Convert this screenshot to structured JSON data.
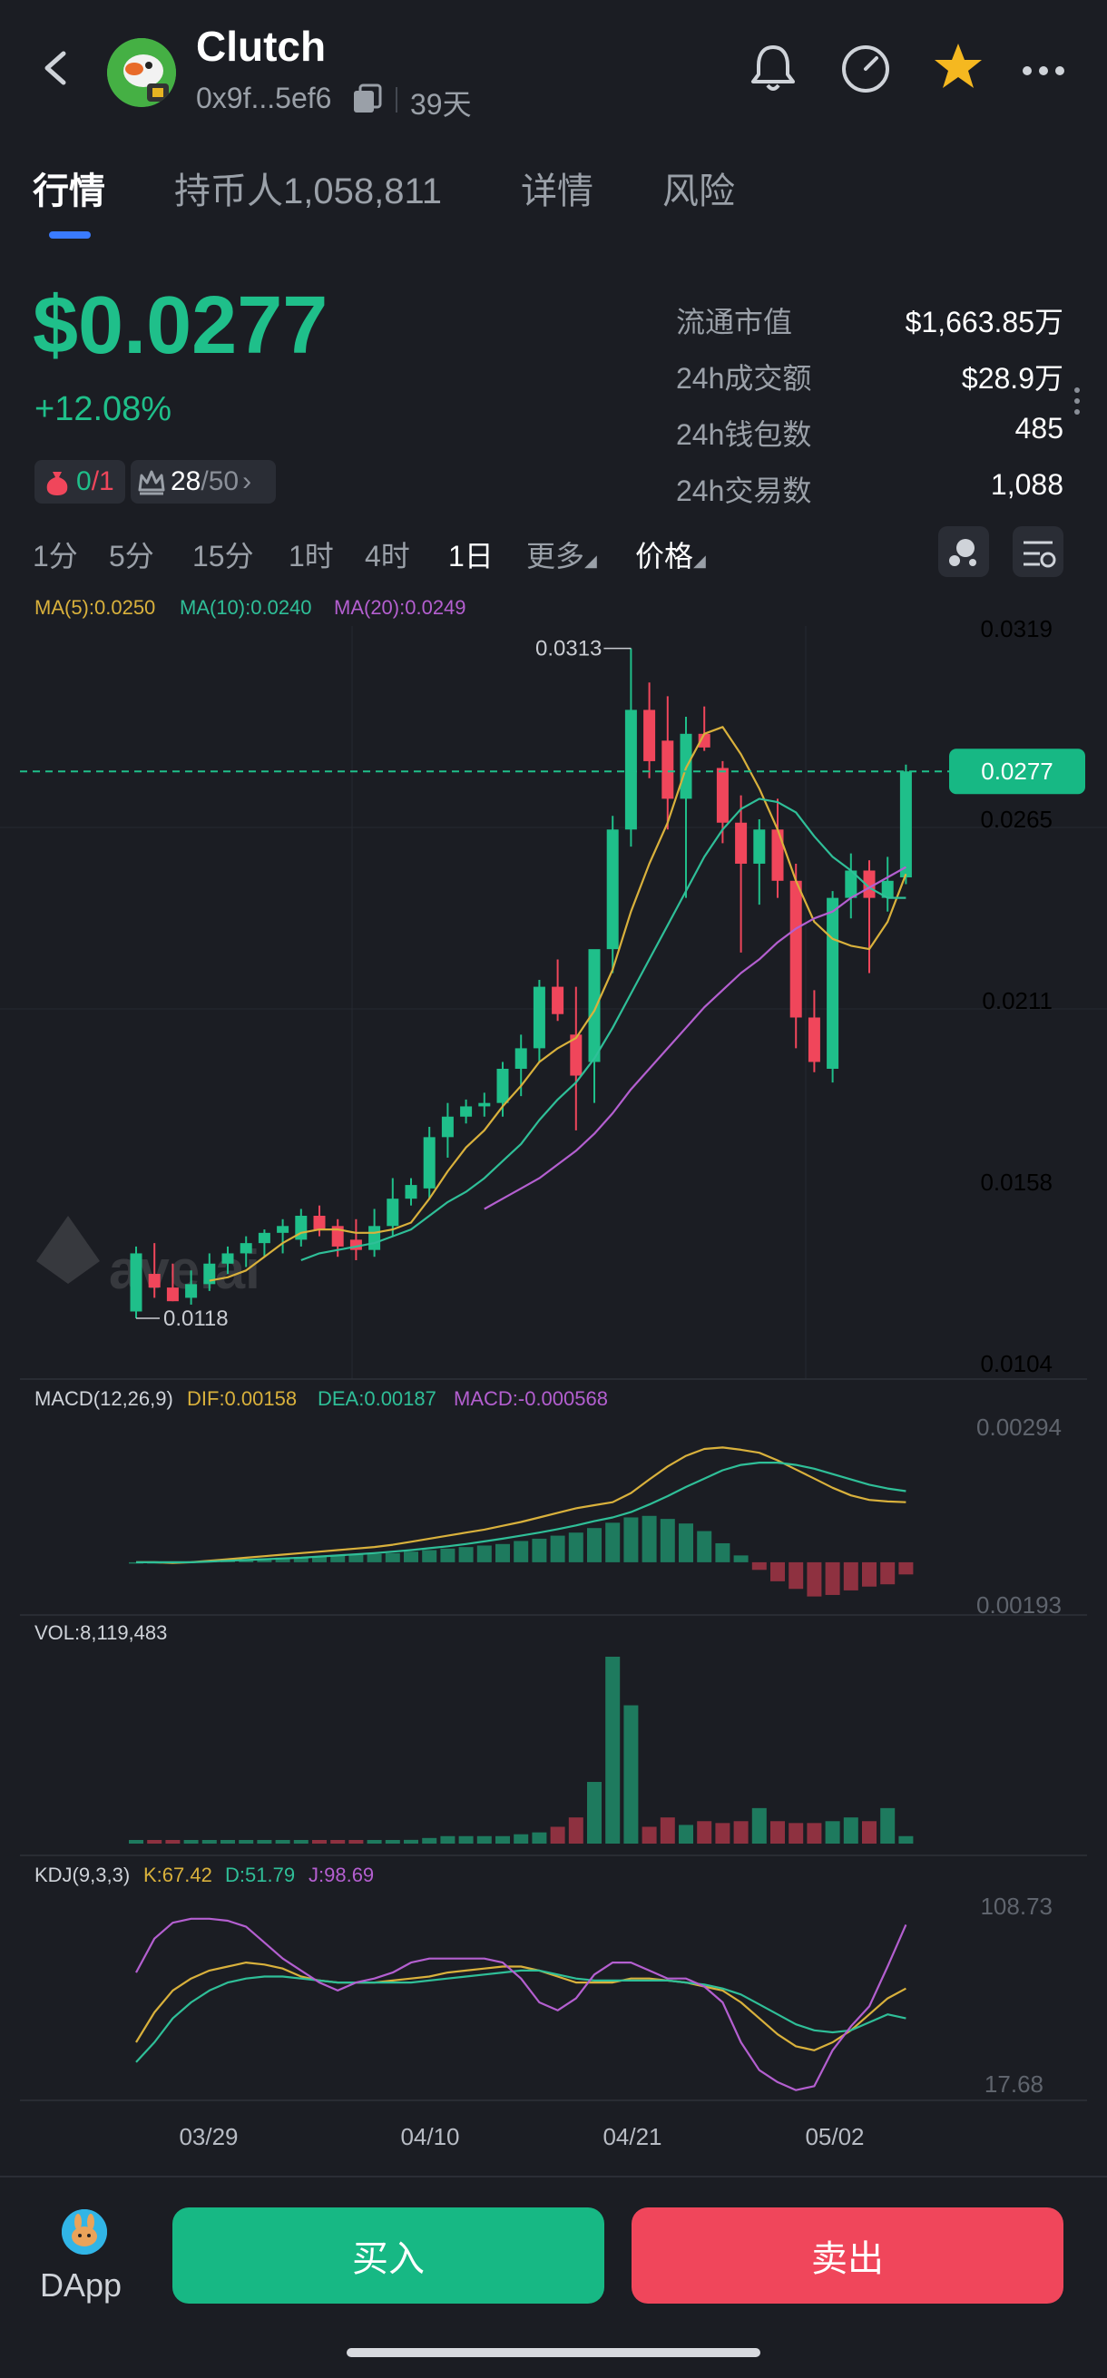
{
  "header": {
    "token_name": "Clutch",
    "address": "0x9f...5ef6",
    "age": "39天",
    "icons": [
      "back-icon",
      "bell-icon",
      "gauge-icon",
      "star-icon",
      "more-icon"
    ]
  },
  "tabs": [
    "行情",
    "持币人1,058,811",
    "详情",
    "风险"
  ],
  "price": {
    "value": "$0.0277",
    "change": "+12.08%",
    "badge1_a": "0",
    "badge1_b": "/1",
    "badge2_a": "28",
    "badge2_b": "/50"
  },
  "stats": [
    {
      "label": "流通市值",
      "value": "$1,663.85万"
    },
    {
      "label": "24h成交额",
      "value": "$28.9万"
    },
    {
      "label": "24h钱包数",
      "value": "485"
    },
    {
      "label": "24h交易数",
      "value": "1,088"
    }
  ],
  "intervals": [
    "1分",
    "5分",
    "15分",
    "1时",
    "4时",
    "1日",
    "更多",
    "价格"
  ],
  "active_interval": "1日",
  "colors": {
    "up": "#1fbf8a",
    "down": "#f0465b",
    "ma5": "#d9b13c",
    "ma10": "#2fbf98",
    "ma20": "#b45fd0",
    "accent": "#3a7bff"
  },
  "chart_data": {
    "type": "candlestick",
    "ma_legend": {
      "ma5": "MA(5):0.0250",
      "ma10": "MA(10):0.0240",
      "ma20": "MA(20):0.0249"
    },
    "y_ticks": [
      "0.0319",
      "0.0265",
      "0.0211",
      "0.0158",
      "0.0104"
    ],
    "high_label": "0.0313",
    "low_label": "0.0118",
    "current_price_tag": "0.0277",
    "x_ticks": [
      "03/29",
      "04/10",
      "04/21",
      "05/02"
    ],
    "candles": [
      {
        "o": 0.0119,
        "h": 0.0138,
        "l": 0.0117,
        "c": 0.0136
      },
      {
        "o": 0.013,
        "h": 0.0139,
        "l": 0.0123,
        "c": 0.0126
      },
      {
        "o": 0.0126,
        "h": 0.0133,
        "l": 0.0122,
        "c": 0.0122
      },
      {
        "o": 0.0123,
        "h": 0.0131,
        "l": 0.0121,
        "c": 0.0127
      },
      {
        "o": 0.0127,
        "h": 0.0136,
        "l": 0.0125,
        "c": 0.0133
      },
      {
        "o": 0.0133,
        "h": 0.0138,
        "l": 0.013,
        "c": 0.0136
      },
      {
        "o": 0.0136,
        "h": 0.0141,
        "l": 0.0132,
        "c": 0.0139
      },
      {
        "o": 0.0139,
        "h": 0.0143,
        "l": 0.0135,
        "c": 0.0142
      },
      {
        "o": 0.0142,
        "h": 0.0146,
        "l": 0.0136,
        "c": 0.0144
      },
      {
        "o": 0.014,
        "h": 0.0149,
        "l": 0.0138,
        "c": 0.0147
      },
      {
        "o": 0.0147,
        "h": 0.015,
        "l": 0.0141,
        "c": 0.0143
      },
      {
        "o": 0.0144,
        "h": 0.0146,
        "l": 0.0135,
        "c": 0.0138
      },
      {
        "o": 0.014,
        "h": 0.0146,
        "l": 0.0134,
        "c": 0.0137
      },
      {
        "o": 0.0137,
        "h": 0.0149,
        "l": 0.0135,
        "c": 0.0144
      },
      {
        "o": 0.0144,
        "h": 0.0158,
        "l": 0.0141,
        "c": 0.0152
      },
      {
        "o": 0.0152,
        "h": 0.0158,
        "l": 0.015,
        "c": 0.0156
      },
      {
        "o": 0.0155,
        "h": 0.0173,
        "l": 0.0152,
        "c": 0.017
      },
      {
        "o": 0.017,
        "h": 0.018,
        "l": 0.0164,
        "c": 0.0176
      },
      {
        "o": 0.0176,
        "h": 0.0181,
        "l": 0.0174,
        "c": 0.0179
      },
      {
        "o": 0.0179,
        "h": 0.0183,
        "l": 0.0176,
        "c": 0.018
      },
      {
        "o": 0.018,
        "h": 0.0192,
        "l": 0.0176,
        "c": 0.019
      },
      {
        "o": 0.019,
        "h": 0.02,
        "l": 0.0182,
        "c": 0.0196
      },
      {
        "o": 0.0196,
        "h": 0.0216,
        "l": 0.0192,
        "c": 0.0214
      },
      {
        "o": 0.0214,
        "h": 0.0222,
        "l": 0.0204,
        "c": 0.0206
      },
      {
        "o": 0.02,
        "h": 0.0214,
        "l": 0.0172,
        "c": 0.0188
      },
      {
        "o": 0.0192,
        "h": 0.0222,
        "l": 0.018,
        "c": 0.0225
      },
      {
        "o": 0.0225,
        "h": 0.0264,
        "l": 0.0218,
        "c": 0.026
      },
      {
        "o": 0.026,
        "h": 0.0313,
        "l": 0.0255,
        "c": 0.0295
      },
      {
        "o": 0.0295,
        "h": 0.0303,
        "l": 0.0275,
        "c": 0.028
      },
      {
        "o": 0.0286,
        "h": 0.0299,
        "l": 0.026,
        "c": 0.0269
      },
      {
        "o": 0.0269,
        "h": 0.0293,
        "l": 0.024,
        "c": 0.0288
      },
      {
        "o": 0.0288,
        "h": 0.0296,
        "l": 0.0283,
        "c": 0.0284
      },
      {
        "o": 0.0278,
        "h": 0.028,
        "l": 0.0256,
        "c": 0.0262
      },
      {
        "o": 0.0262,
        "h": 0.027,
        "l": 0.0224,
        "c": 0.025
      },
      {
        "o": 0.025,
        "h": 0.0263,
        "l": 0.0238,
        "c": 0.026
      },
      {
        "o": 0.026,
        "h": 0.0269,
        "l": 0.024,
        "c": 0.0245
      },
      {
        "o": 0.0245,
        "h": 0.025,
        "l": 0.0196,
        "c": 0.0205
      },
      {
        "o": 0.0205,
        "h": 0.0213,
        "l": 0.0189,
        "c": 0.0192
      },
      {
        "o": 0.019,
        "h": 0.0242,
        "l": 0.0186,
        "c": 0.024
      },
      {
        "o": 0.024,
        "h": 0.0253,
        "l": 0.0234,
        "c": 0.0248
      },
      {
        "o": 0.0248,
        "h": 0.0251,
        "l": 0.0218,
        "c": 0.024
      },
      {
        "o": 0.024,
        "h": 0.0252,
        "l": 0.0236,
        "c": 0.0245
      },
      {
        "o": 0.0246,
        "h": 0.0279,
        "l": 0.0244,
        "c": 0.0277
      }
    ],
    "ma5": [
      null,
      null,
      null,
      null,
      0.0128,
      0.0129,
      0.0131,
      0.0135,
      0.0139,
      0.0142,
      0.0143,
      0.0143,
      0.0142,
      0.0142,
      0.0143,
      0.0145,
      0.0152,
      0.016,
      0.0167,
      0.0172,
      0.0179,
      0.0185,
      0.0192,
      0.0196,
      0.0199,
      0.0207,
      0.0219,
      0.0236,
      0.025,
      0.0262,
      0.0278,
      0.0288,
      0.029,
      0.0282,
      0.0272,
      0.026,
      0.0245,
      0.0233,
      0.0228,
      0.0226,
      0.0225,
      0.0233,
      0.0247
    ],
    "ma10": [
      null,
      null,
      null,
      null,
      null,
      null,
      null,
      null,
      null,
      0.0134,
      0.0136,
      0.0137,
      0.0138,
      0.0139,
      0.0141,
      0.0143,
      0.0147,
      0.0151,
      0.0154,
      0.0158,
      0.0163,
      0.0168,
      0.0175,
      0.0181,
      0.0186,
      0.0193,
      0.0202,
      0.0212,
      0.0222,
      0.0232,
      0.0242,
      0.0252,
      0.026,
      0.0266,
      0.0269,
      0.0268,
      0.0265,
      0.0258,
      0.0252,
      0.0248,
      0.0243,
      0.024,
      0.024
    ],
    "ma20": [
      null,
      null,
      null,
      null,
      null,
      null,
      null,
      null,
      null,
      null,
      null,
      null,
      null,
      null,
      null,
      null,
      null,
      null,
      null,
      0.0149,
      0.0152,
      0.0155,
      0.0158,
      0.0162,
      0.0166,
      0.0171,
      0.0177,
      0.0184,
      0.019,
      0.0196,
      0.0202,
      0.0208,
      0.0213,
      0.0218,
      0.0222,
      0.0227,
      0.0231,
      0.0234,
      0.0236,
      0.024,
      0.0243,
      0.0246,
      0.0249
    ],
    "macd": {
      "legend": {
        "title": "MACD(12,26,9)",
        "dif": "DIF:0.00158",
        "dea": "DEA:0.00187",
        "macd": "MACD:-0.000568"
      },
      "y_ticks": [
        "0.00294",
        "0.00193"
      ],
      "hist": [
        0,
        0,
        0,
        2e-05,
        4e-05,
        6e-05,
        8e-05,
        0.0001,
        0.00012,
        0.00014,
        0.00016,
        0.00018,
        0.0002,
        0.00022,
        0.00024,
        0.00028,
        0.00032,
        0.00036,
        0.0004,
        0.00044,
        0.00048,
        0.00056,
        0.00062,
        0.0007,
        0.00078,
        0.0009,
        0.00104,
        0.00118,
        0.00122,
        0.00114,
        0.00102,
        0.00082,
        0.0005,
        0.00018,
        -0.0002,
        -0.0005,
        -0.0007,
        -0.0009,
        -0.00086,
        -0.00074,
        -0.00064,
        -0.00058,
        -0.00032
      ],
      "dif": [
        0,
        0,
        -2e-05,
        0,
        4e-05,
        8e-05,
        0.00012,
        0.00016,
        0.0002,
        0.00024,
        0.00028,
        0.00032,
        0.00036,
        0.0004,
        0.00046,
        0.00054,
        0.00062,
        0.0007,
        0.00078,
        0.00086,
        0.00096,
        0.00106,
        0.00118,
        0.0013,
        0.00142,
        0.0015,
        0.00158,
        0.00182,
        0.00218,
        0.00252,
        0.0028,
        0.00298,
        0.00302,
        0.00296,
        0.00288,
        0.00268,
        0.00244,
        0.0022,
        0.00196,
        0.00176,
        0.00164,
        0.0016,
        0.00158
      ],
      "dea": [
        0,
        0,
        0,
        0,
        2e-05,
        4e-05,
        6e-05,
        8e-05,
        0.0001,
        0.00012,
        0.00015,
        0.00018,
        0.00021,
        0.00024,
        0.00028,
        0.00032,
        0.00037,
        0.00042,
        0.00048,
        0.00055,
        0.00062,
        0.0007,
        0.00078,
        0.00087,
        0.00097,
        0.00108,
        0.00118,
        0.00132,
        0.00152,
        0.00174,
        0.00198,
        0.0022,
        0.00242,
        0.00256,
        0.00262,
        0.00262,
        0.00256,
        0.00246,
        0.00232,
        0.00218,
        0.00204,
        0.00194,
        0.00187
      ]
    },
    "volume": {
      "legend": "VOL:8,119,483",
      "bars": [
        1,
        1,
        1,
        1,
        1,
        1,
        1,
        1,
        1,
        1,
        1,
        1,
        1,
        1,
        1,
        2,
        3,
        4,
        4,
        4,
        4,
        5,
        6,
        9,
        14,
        33,
        100,
        74,
        9,
        14,
        10,
        12,
        11,
        12,
        19,
        12,
        11,
        11,
        12,
        14,
        12,
        19,
        4
      ]
    },
    "kdj": {
      "legend": {
        "title": "KDJ(9,3,3)",
        "k": "K:67.42",
        "d": "D:51.79",
        "j": "J:98.69"
      },
      "y_ticks": [
        "108.73",
        "17.68"
      ],
      "k": [
        40,
        55,
        66,
        72,
        76,
        78,
        80,
        79,
        77,
        73,
        71,
        70,
        70,
        70,
        71,
        72,
        73,
        75,
        76,
        77,
        78,
        78,
        76,
        73,
        70,
        70,
        70,
        72,
        72,
        71,
        70,
        68,
        66,
        60,
        52,
        44,
        38,
        36,
        40,
        46,
        54,
        62,
        67
      ],
      "d": [
        30,
        40,
        52,
        60,
        66,
        70,
        72,
        73,
        73,
        72,
        71,
        70,
        70,
        70,
        70,
        70,
        71,
        72,
        73,
        74,
        75,
        76,
        76,
        74,
        72,
        71,
        71,
        71,
        71,
        71,
        70,
        69,
        67,
        64,
        59,
        54,
        49,
        46,
        45,
        46,
        50,
        54,
        52
      ],
      "j": [
        75,
        92,
        100,
        102,
        102,
        101,
        98,
        90,
        82,
        76,
        70,
        66,
        70,
        72,
        75,
        80,
        82,
        82,
        82,
        82,
        80,
        72,
        60,
        56,
        62,
        74,
        80,
        80,
        76,
        72,
        72,
        68,
        60,
        40,
        26,
        20,
        16,
        18,
        36,
        48,
        58,
        78,
        99
      ]
    }
  },
  "bottom": {
    "dapp": "DApp",
    "buy": "买入",
    "sell": "卖出"
  }
}
